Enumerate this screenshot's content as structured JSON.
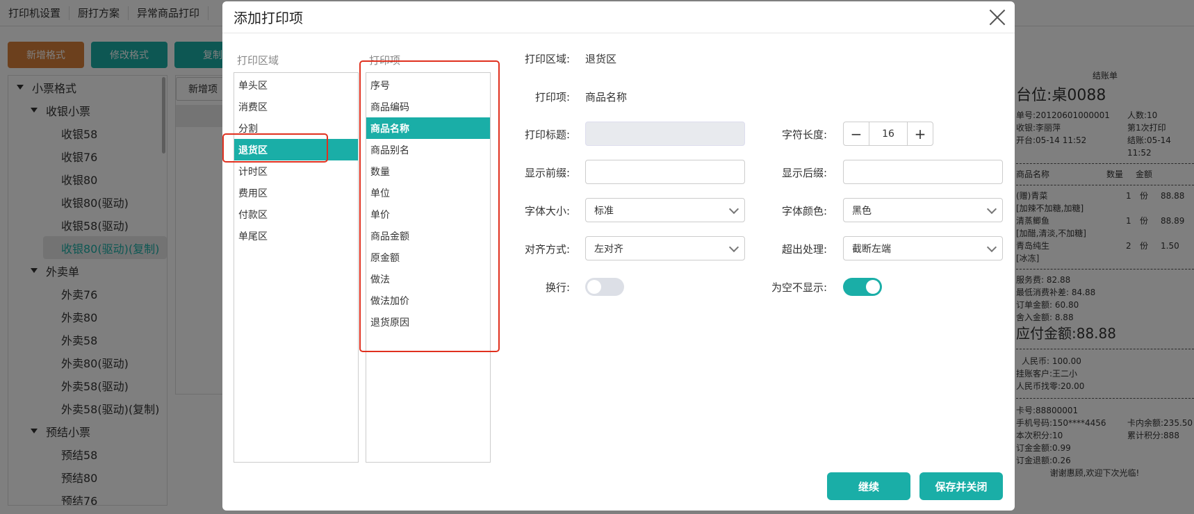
{
  "topnav": [
    "打印机设置",
    "厨打方案",
    "异常商品打印"
  ],
  "toolbar": {
    "new_format": "新增格式",
    "edit_format": "修改格式",
    "copy": "复制",
    "new_format_color": "#d9803a",
    "teal": "#1aaea7"
  },
  "tree": {
    "root": "小票格式",
    "groups": [
      {
        "label": "收银小票",
        "items": [
          "收银58",
          "收银76",
          "收银80",
          "收银80(驱动)",
          "收银58(驱动)",
          "收银80(驱动)(复制)"
        ]
      },
      {
        "label": "外卖单",
        "items": [
          "外卖76",
          "外卖80",
          "外卖58",
          "外卖80(驱动)",
          "外卖58(驱动)",
          "外卖58(驱动)(复制)"
        ]
      },
      {
        "label": "预结小票",
        "items": [
          "预结58",
          "预结80",
          "预结76"
        ]
      }
    ],
    "selected": "收银80(驱动)(复制)"
  },
  "subpanel": {
    "add_item": "新增项"
  },
  "dialog": {
    "title": "添加打印项",
    "areas_title": "打印区域",
    "items_title": "打印项",
    "areas": [
      "单头区",
      "消费区",
      "分割",
      "退货区",
      "计时区",
      "费用区",
      "付款区",
      "单尾区"
    ],
    "area_selected": "退货区",
    "items": [
      "序号",
      "商品编码",
      "商品名称",
      "商品别名",
      "数量",
      "单位",
      "单价",
      "商品金额",
      "原金额",
      "做法",
      "做法加价",
      "退货原因"
    ],
    "item_selected": "商品名称",
    "form": {
      "print_area_label": "打印区域:",
      "print_area_value": "退货区",
      "print_item_label": "打印项:",
      "print_item_value": "商品名称",
      "print_title_label": "打印标题:",
      "char_length_label": "字符长度:",
      "char_length_value": "16",
      "stepper_minus": "−",
      "stepper_plus": "+",
      "prefix_label": "显示前缀:",
      "suffix_label": "显示后缀:",
      "font_size_label": "字体大小:",
      "font_size_value": "标准",
      "font_color_label": "字体颜色:",
      "font_color_value": "黑色",
      "align_label": "对齐方式:",
      "align_value": "左对齐",
      "overflow_label": "超出处理:",
      "overflow_value": "截断左端",
      "wrap_label": "换行:",
      "wrap_on": false,
      "hide_empty_label": "为空不显示:",
      "hide_empty_on": true
    },
    "buttons": {
      "continue": "继续",
      "save_close": "保存并关闭"
    }
  },
  "receipt": {
    "title": "结账单",
    "table": "台位:桌0088",
    "order_no": "单号:20120601000001",
    "people": "人数:10",
    "cashier": "收银:李丽萍",
    "print_count": "第1次打印",
    "open_time": "开台:05-14 11:52",
    "close_time": "结账:05-14 11:52",
    "headers": [
      "商品名称",
      "数量",
      "金额"
    ],
    "items": [
      {
        "name": "(赠)青菜",
        "qty": "1",
        "unit": "份",
        "amount": "88.88",
        "note": "[加辣不加糖,加糖]"
      },
      {
        "name": "清蒸鲫鱼",
        "qty": "1",
        "unit": "份",
        "amount": "88.89",
        "note": "[加醋,清淡,不加糖]"
      },
      {
        "name": "青岛纯生",
        "qty": "2",
        "unit": "份",
        "amount": "1.50",
        "note": "[冰冻]"
      }
    ],
    "service_fee": "服务费:    82.88",
    "min_spend": "最低消费补差:    84.88",
    "order_amount": "订单金额:    60.80",
    "rounding": "舍入金额:    8.88",
    "payable": "应付金额:88.88",
    "rmb": "人民币:    100.00",
    "credit_customer": "挂账客户:王二小",
    "change": "人民币找零:20.00",
    "card_no": "卡号:88800001",
    "phone": "手机号码:150****4456",
    "card_balance": "卡内余额:235.50",
    "points_this": "本次积分:10",
    "points_total": "累计积分:888",
    "deposit_amount": "订金金额:0.99",
    "deposit_refund": "订金退额:0.26",
    "thanks": "谢谢惠顾,欢迎下次光临!"
  }
}
